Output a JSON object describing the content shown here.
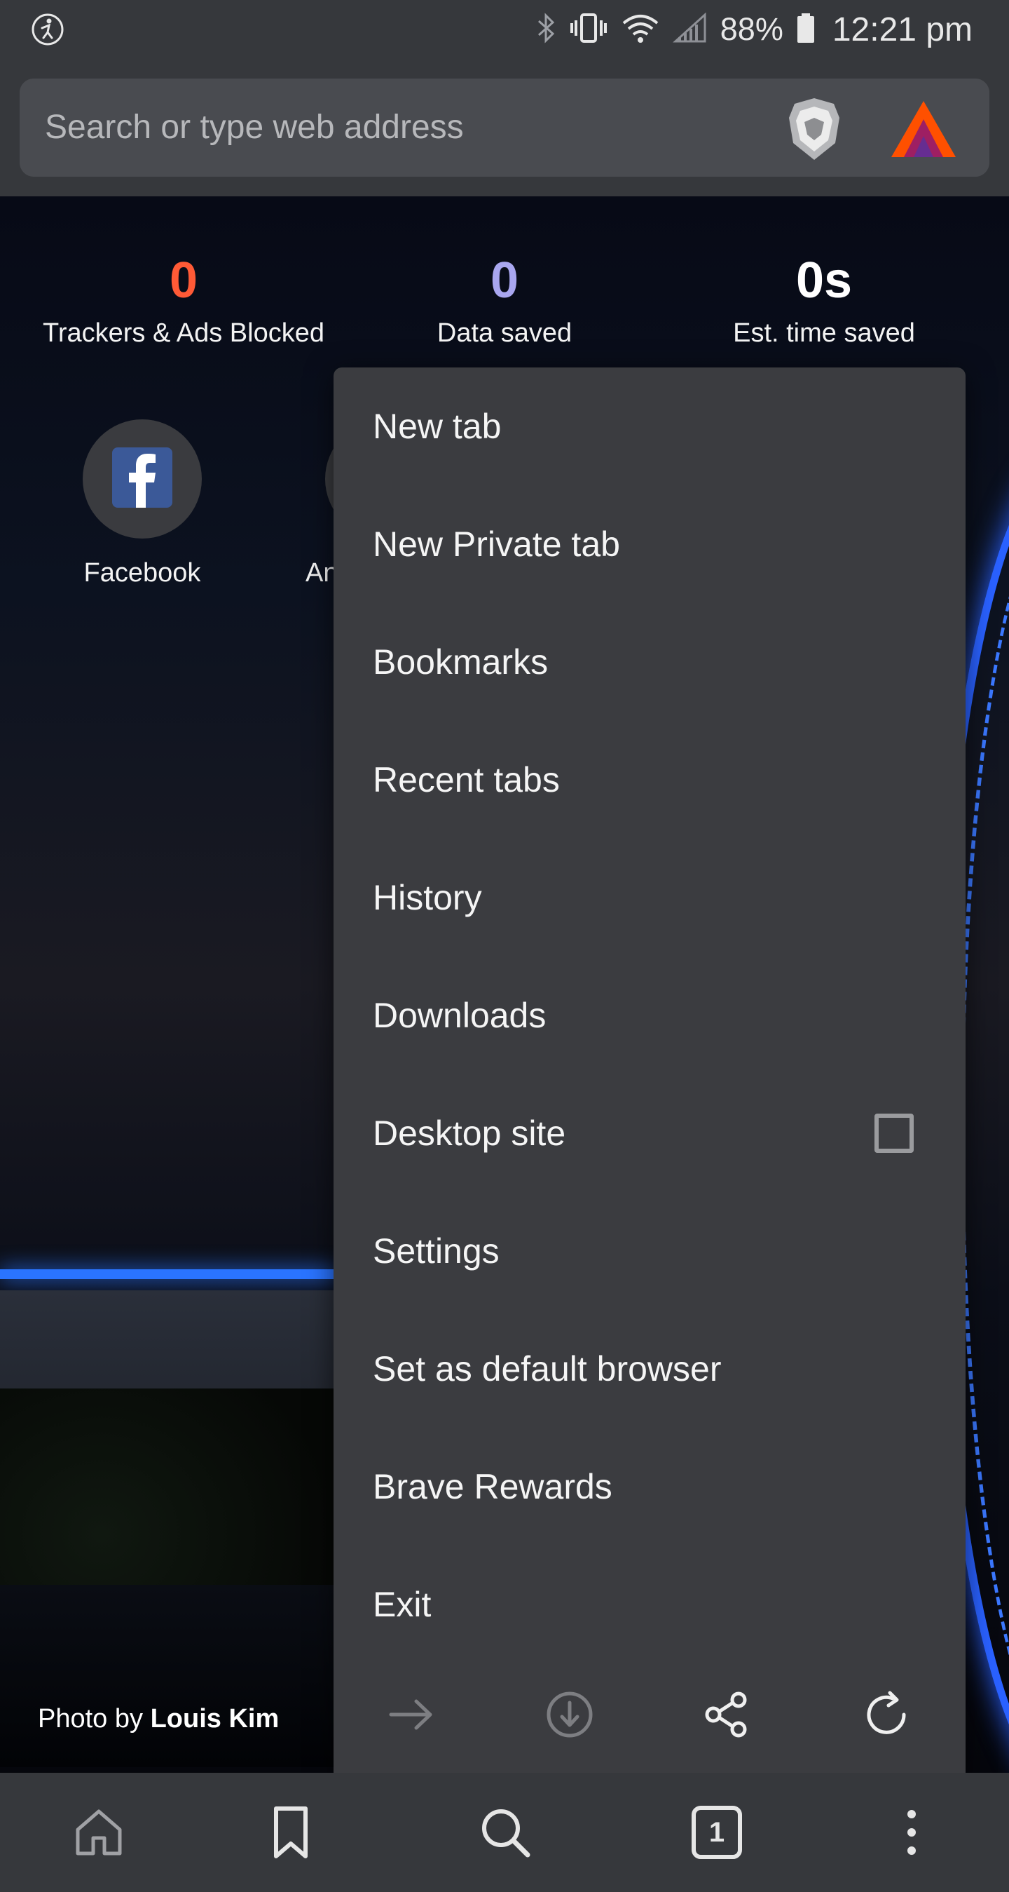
{
  "status_bar": {
    "battery": "88%",
    "time": "12:21 pm",
    "icons": [
      "accessibility-icon",
      "bluetooth-icon",
      "vibrate-icon",
      "wifi-icon",
      "cell-signal-icon",
      "battery-icon"
    ]
  },
  "toolbar": {
    "search_placeholder": "Search or type web address",
    "shield_icon": "brave-shield-icon",
    "rewards_icon": "bat-rewards-icon"
  },
  "stats": [
    {
      "value": "0",
      "label": "Trackers & Ads Blocked",
      "color": "#ff5a36"
    },
    {
      "value": "0",
      "label": "Data saved",
      "color": "#a9a7f0"
    },
    {
      "value": "0s",
      "label": "Est. time saved",
      "color": "#ffffff"
    }
  ],
  "top_sites": [
    {
      "label": "Facebook",
      "icon": "facebook-icon"
    },
    {
      "label": "An",
      "icon": "site-icon"
    }
  ],
  "photo_credit": {
    "prefix": "Photo by",
    "author": "Louis Kim"
  },
  "menu": {
    "items": [
      {
        "label": "New tab"
      },
      {
        "label": "New Private tab"
      },
      {
        "label": "Bookmarks"
      },
      {
        "label": "Recent tabs"
      },
      {
        "label": "History"
      },
      {
        "label": "Downloads"
      },
      {
        "label": "Desktop site",
        "checked": false
      },
      {
        "label": "Settings"
      },
      {
        "label": "Set as default browser"
      },
      {
        "label": "Brave Rewards"
      },
      {
        "label": "Exit"
      }
    ],
    "actions": [
      "forward-icon",
      "download-icon",
      "share-icon",
      "reload-icon"
    ]
  },
  "bottom_bar": {
    "tab_count": "1",
    "icons": [
      "home-icon",
      "bookmark-icon",
      "search-icon",
      "tabs-icon",
      "more-vertical-icon"
    ]
  },
  "colors": {
    "bar_bg": "#36383c",
    "menu_bg": "#3b3c40",
    "accent_orange": "#ff5a36",
    "accent_purple": "#a9a7f0"
  }
}
